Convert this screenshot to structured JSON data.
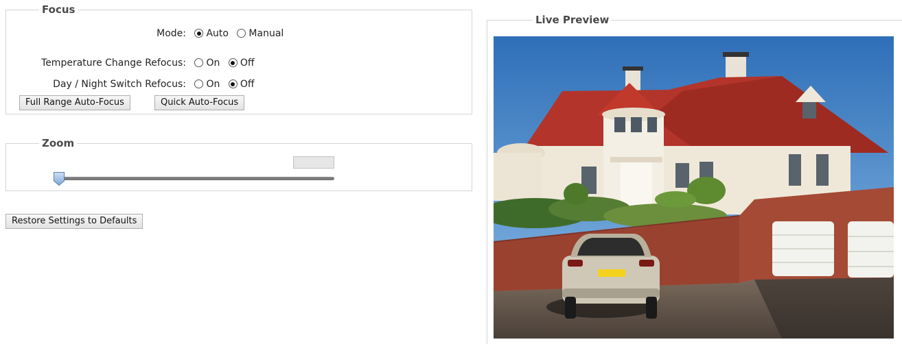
{
  "focus": {
    "title": "Focus",
    "mode_label": "Mode:",
    "mode_options": [
      "Auto",
      "Manual"
    ],
    "mode_selected": "Auto",
    "temp_label": "Temperature Change Refocus:",
    "temp_options": [
      "On",
      "Off"
    ],
    "temp_selected": "Off",
    "daynight_label": "Day / Night Switch Refocus:",
    "daynight_options": [
      "On",
      "Off"
    ],
    "daynight_selected": "Off",
    "full_range_button": "Full Range Auto-Focus",
    "quick_button": "Quick Auto-Focus"
  },
  "zoom": {
    "title": "Zoom",
    "value": "",
    "level": 0
  },
  "restore_button": "Restore Settings to Defaults",
  "live_preview": {
    "title": "Live Preview"
  },
  "colors": {
    "border": "#d4d4d4",
    "legend_text": "#4a4a4a",
    "slider_thumb": "#8fb3df"
  }
}
